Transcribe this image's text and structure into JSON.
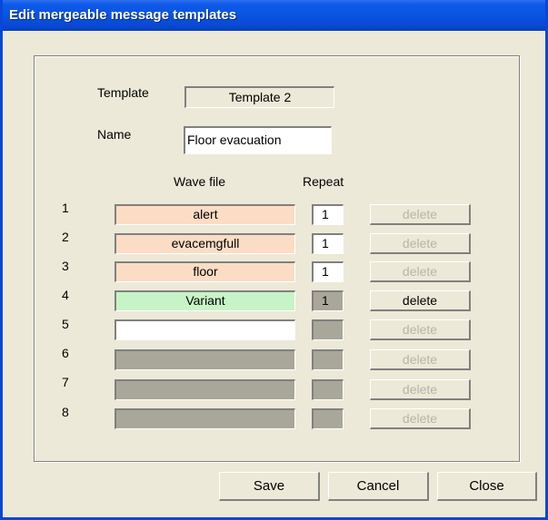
{
  "window": {
    "title": "Edit mergeable message templates"
  },
  "form": {
    "template_label": "Template",
    "template_value": "Template 2",
    "name_label": "Name",
    "name_value": "Floor evacuation",
    "wave_header": "Wave file",
    "repeat_header": "Repeat"
  },
  "rows": [
    {
      "num": "1",
      "wave": "alert",
      "repeat": "1",
      "delete_label": "delete",
      "state": "filled"
    },
    {
      "num": "2",
      "wave": "evacemgfull",
      "repeat": "1",
      "delete_label": "delete",
      "state": "filled"
    },
    {
      "num": "3",
      "wave": "floor",
      "repeat": "1",
      "delete_label": "delete",
      "state": "filled"
    },
    {
      "num": "4",
      "wave": "Variant",
      "repeat": "1",
      "delete_label": "delete",
      "state": "variant"
    },
    {
      "num": "5",
      "wave": "",
      "repeat": "",
      "delete_label": "delete",
      "state": "empty"
    },
    {
      "num": "6",
      "wave": "",
      "repeat": "",
      "delete_label": "delete",
      "state": "disabled"
    },
    {
      "num": "7",
      "wave": "",
      "repeat": "",
      "delete_label": "delete",
      "state": "disabled"
    },
    {
      "num": "8",
      "wave": "",
      "repeat": "",
      "delete_label": "delete",
      "state": "disabled"
    }
  ],
  "buttons": {
    "save": "Save",
    "cancel": "Cancel",
    "close": "Close"
  },
  "colors": {
    "filled_wave": "#fbdcc4",
    "variant_wave": "#c6f4c6",
    "disabled_field": "#a8a799",
    "titlebar": "#0a54e0"
  }
}
